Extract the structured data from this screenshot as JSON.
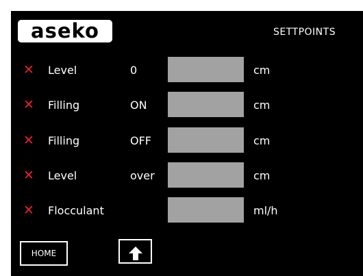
{
  "header": {
    "logo": "aseko",
    "title": "SETTPOINTS"
  },
  "status_icon": "close-icon",
  "colors": {
    "status_x": "#e8202a",
    "field_bg": "#a2a2a2",
    "screen_bg": "#000000"
  },
  "rows": [
    {
      "label": "Level",
      "qualifier": "0",
      "value": "",
      "unit": "cm"
    },
    {
      "label": "Filling",
      "qualifier": "ON",
      "value": "",
      "unit": "cm"
    },
    {
      "label": "Filling",
      "qualifier": "OFF",
      "value": "",
      "unit": "cm"
    },
    {
      "label": "Level",
      "qualifier": "over",
      "value": "",
      "unit": "cm"
    },
    {
      "label": "Flocculant",
      "qualifier": "",
      "value": "",
      "unit": "ml/h"
    }
  ],
  "footer": {
    "home_label": "HOME",
    "up_icon": "arrow-up-icon"
  }
}
